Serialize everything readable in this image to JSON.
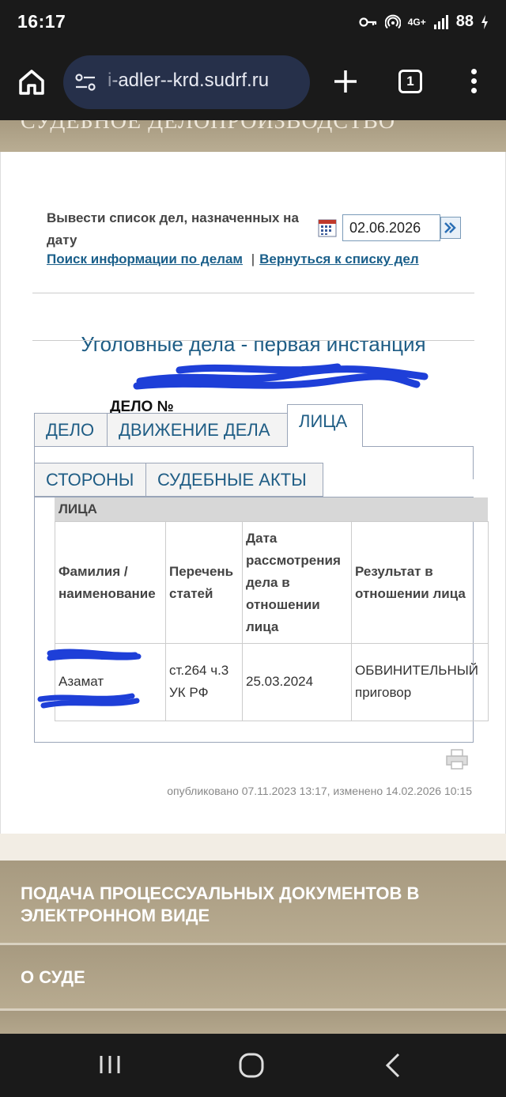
{
  "status_bar": {
    "time": "16:17",
    "network": "4G+",
    "battery": "88"
  },
  "browser": {
    "url": "i-adler--krd.sudrf.ru",
    "tab_count": "1"
  },
  "banner": {
    "text": "СУДЕБНОЕ ДЕЛОПРОИЗВОДСТВО"
  },
  "date_filter": {
    "label": "Вывести список дел, назначенных на дату",
    "value": "02.06.2026"
  },
  "links": {
    "search": "Поиск информации по делам",
    "separator": "|",
    "back": "Вернуться к списку дел"
  },
  "section_title": "Уголовные дела - первая инстанция",
  "case_prefix": "ДЕЛО №",
  "tabs": {
    "row1": [
      {
        "label": "ДЕЛО"
      },
      {
        "label": "ДВИЖЕНИЕ ДЕЛА"
      },
      {
        "label": "ЛИЦА"
      }
    ],
    "row2": [
      {
        "label": "СТОРОНЫ"
      },
      {
        "label": "СУДЕБНЫЕ АКТЫ"
      }
    ]
  },
  "persons": {
    "group_title": "ЛИЦА",
    "headers": [
      "Фамилия / наименование",
      "Перечень статей",
      "Дата рассмотрения дела в отношении лица",
      "Результат в отношении лица"
    ],
    "rows": [
      {
        "name": "Азамат",
        "articles": "ст.264 ч.3 УК РФ",
        "date": "25.03.2024",
        "result": "ОБВИНИТЕЛЬНЫЙ приговор"
      }
    ]
  },
  "published": "опубликовано 07.11.2023 13:17, изменено 14.02.2026 10:15",
  "footer_menu": [
    {
      "label": "ПОДАЧА ПРОЦЕССУАЛЬНЫХ ДОКУМЕНТОВ В ЭЛЕКТРОННОМ ВИДЕ"
    },
    {
      "label": "О СУДЕ"
    }
  ],
  "colors": {
    "link": "#1a5f8a",
    "heading": "#1f5d85",
    "banner": "#a79a80",
    "redaction": "#1e3fd8"
  },
  "icons": [
    "key-icon",
    "hotspot-icon",
    "signal-icon",
    "battery-charging-icon",
    "home-icon",
    "site-settings-icon",
    "plus-icon",
    "tabs-icon",
    "more-vert-icon",
    "calendar-icon",
    "arrow-go-icon",
    "print-icon",
    "recents-icon",
    "home-circle-icon",
    "back-icon"
  ]
}
